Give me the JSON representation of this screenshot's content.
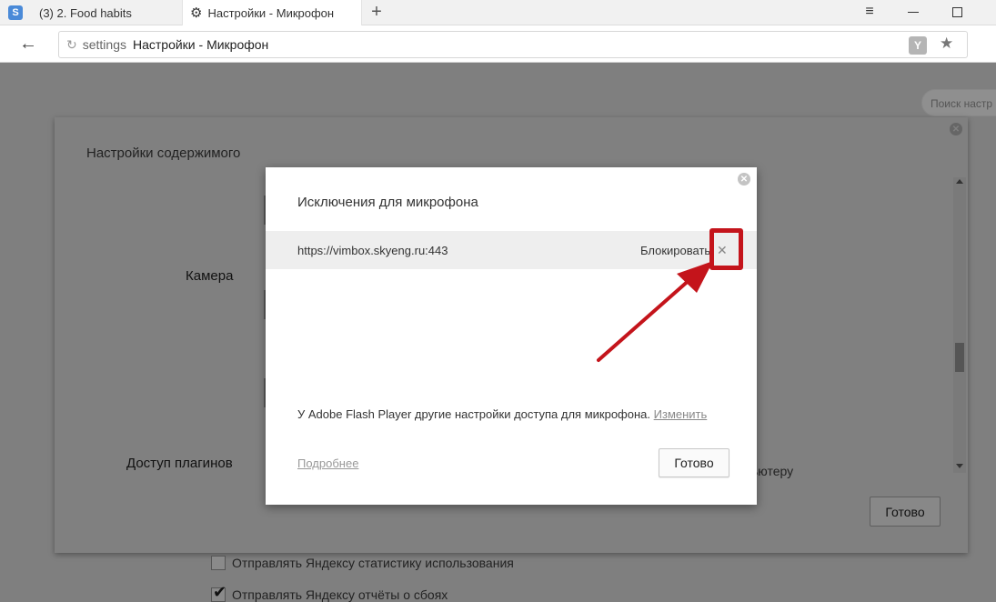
{
  "tabs": [
    {
      "label": "(3) 2. Food habits",
      "icon": "s-favicon-icon",
      "icon_letter": "S"
    },
    {
      "label": "Настройки - Микрофон",
      "icon": "gear-icon"
    }
  ],
  "address_bar": {
    "scheme": "settings",
    "title": "Настройки - Микрофон",
    "yandex_letter": "Y"
  },
  "background_page": {
    "search_placeholder": "Поиск настр",
    "checkbox_stats": "Отправлять Яндексу статистику использования",
    "checkbox_crashes": "Отправлять Яндексу отчёты о сбоях"
  },
  "content_settings": {
    "title": "Настройки содержимого",
    "camera_label": "Камера",
    "plugins_label": "Доступ плагинов",
    "partial_text": "ьютеру",
    "done_label": "Готово"
  },
  "dialog": {
    "title": "Исключения для микрофона",
    "exceptions": [
      {
        "host": "https://vimbox.skyeng.ru:443",
        "action": "Блокировать"
      }
    ],
    "flash_note": "У Adobe Flash Player другие настройки доступа для микрофона.",
    "flash_link": "Изменить",
    "more_link": "Подробнее",
    "done_label": "Готово"
  },
  "colors": {
    "annotation_red": "#c4141b",
    "link_gray": "#888888"
  }
}
